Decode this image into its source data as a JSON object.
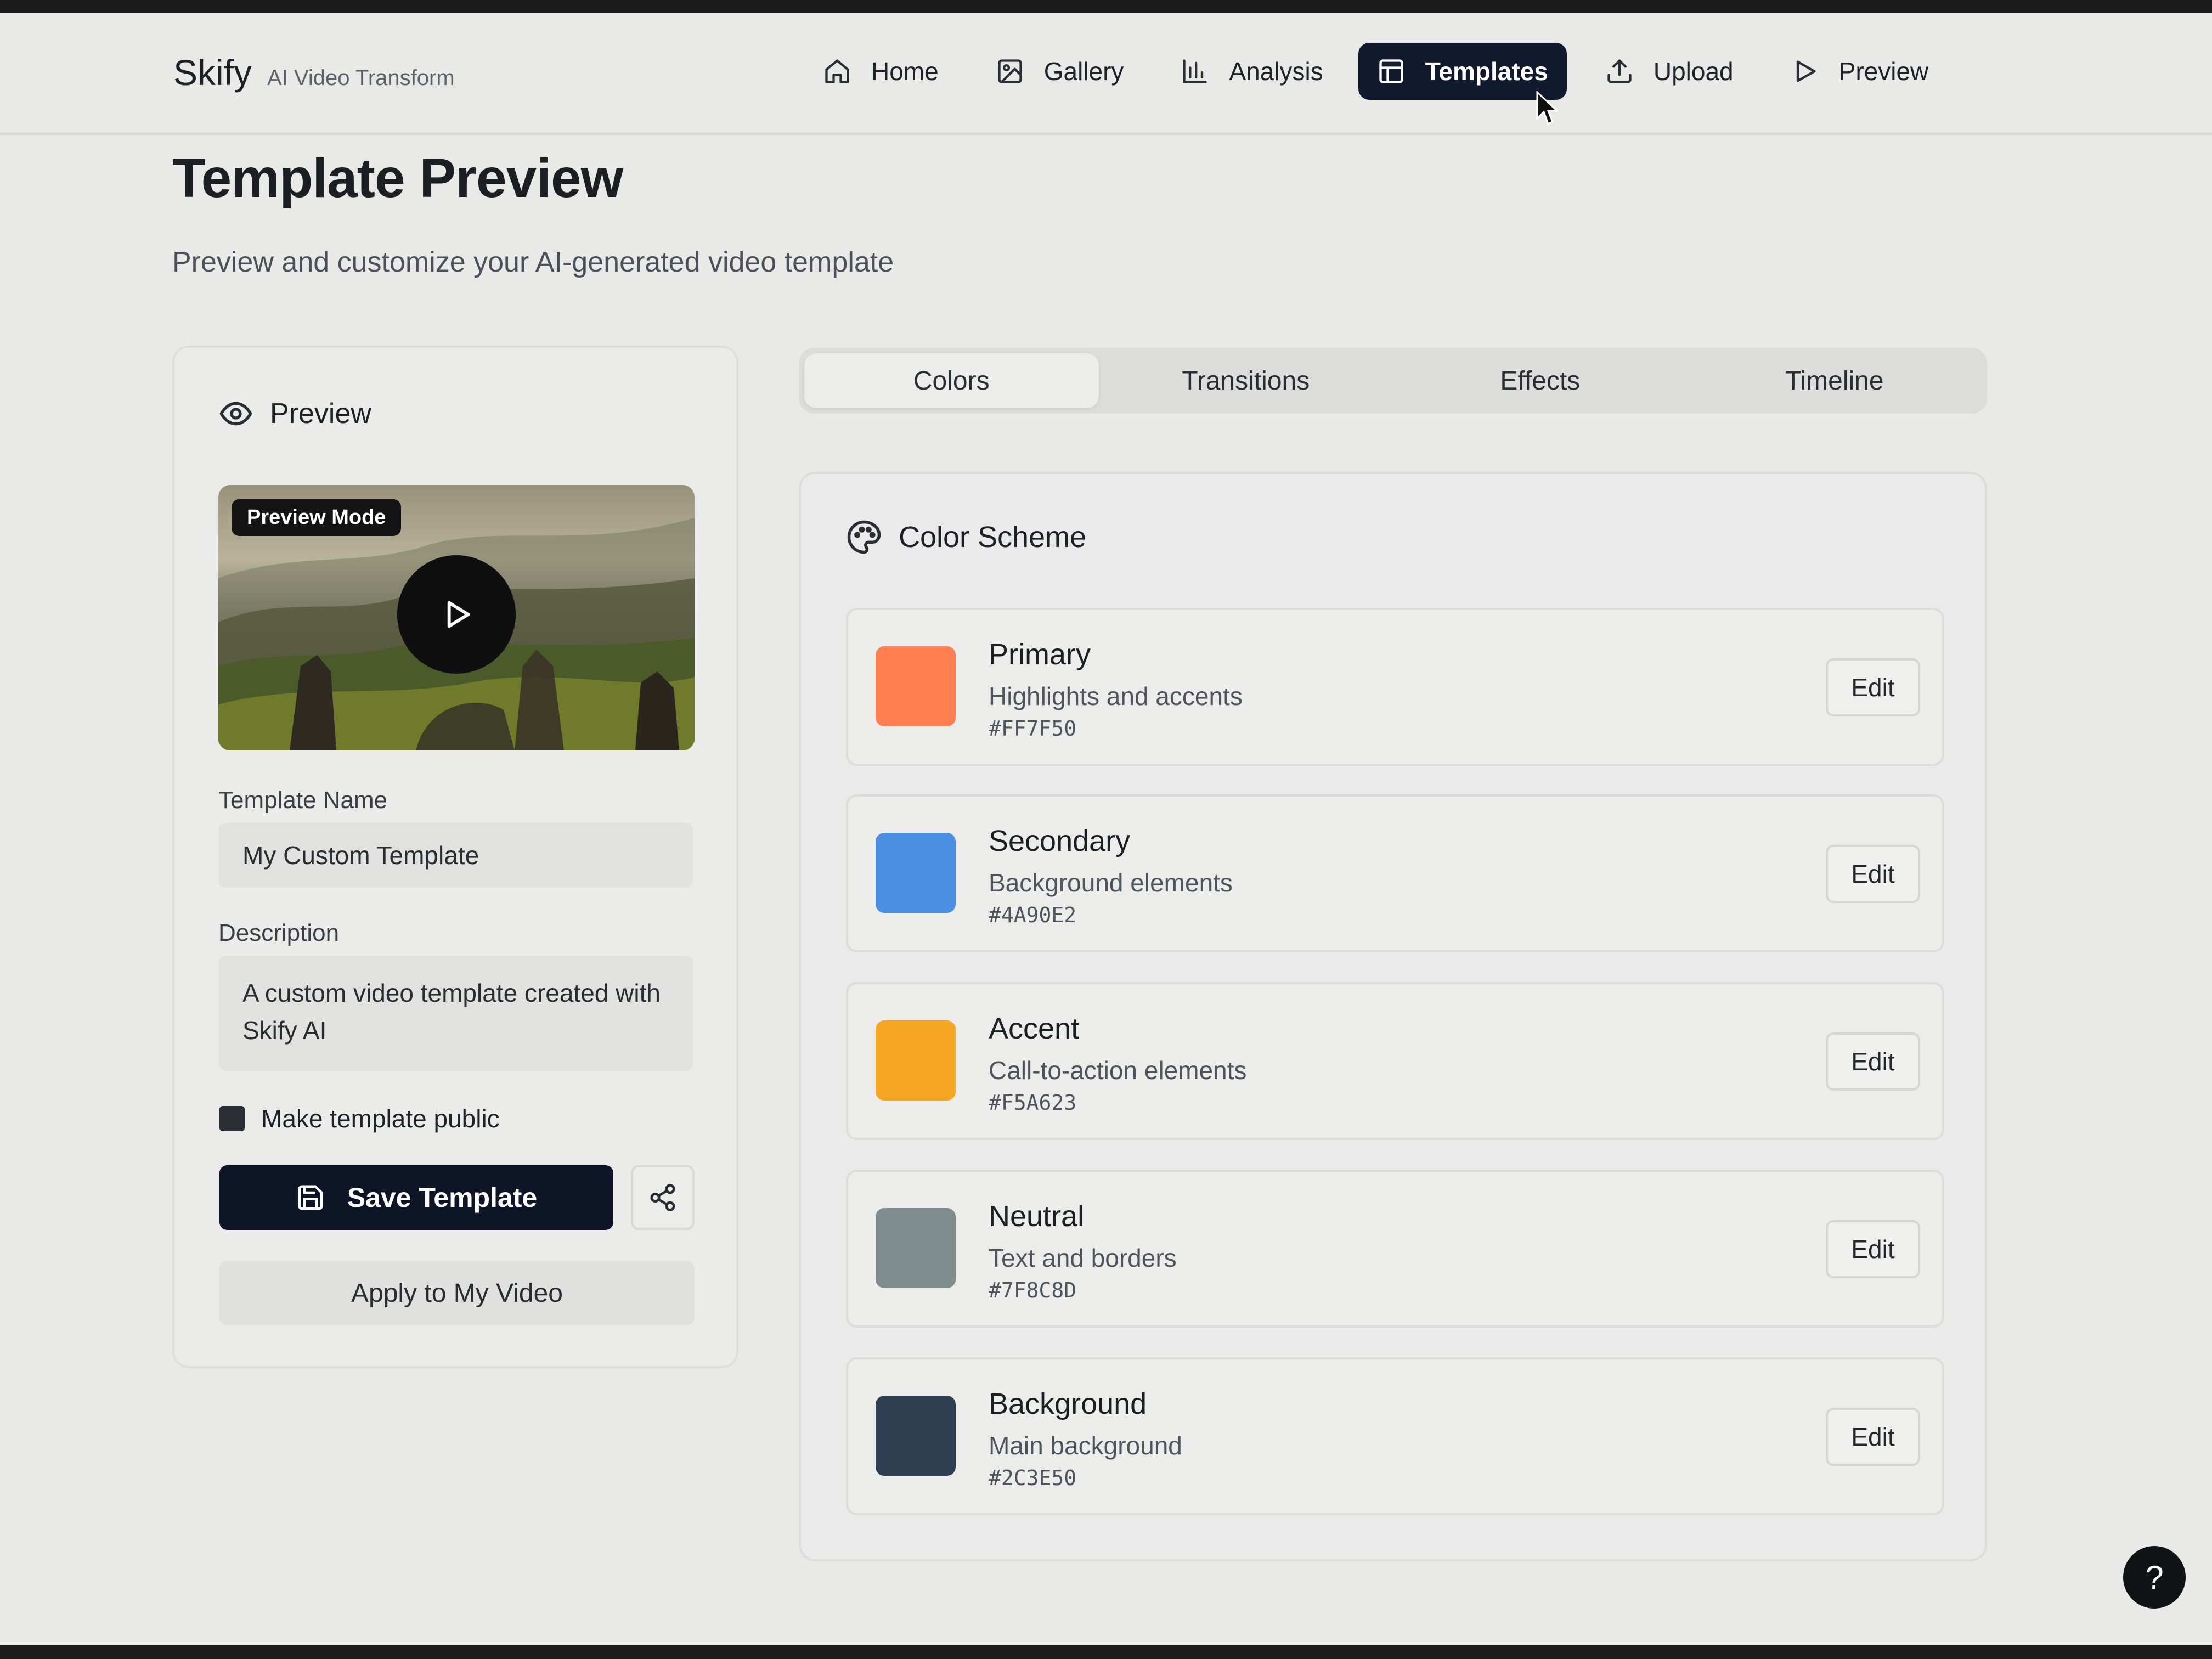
{
  "brand": {
    "name": "Skify",
    "tagline": "AI Video Transform"
  },
  "nav": [
    {
      "label": "Home",
      "icon": "home-icon",
      "active": false
    },
    {
      "label": "Gallery",
      "icon": "image-icon",
      "active": false
    },
    {
      "label": "Analysis",
      "icon": "bar-chart-icon",
      "active": false
    },
    {
      "label": "Templates",
      "icon": "layout-icon",
      "active": true
    },
    {
      "label": "Upload",
      "icon": "upload-icon",
      "active": false
    },
    {
      "label": "Preview",
      "icon": "play-icon",
      "active": false
    }
  ],
  "page": {
    "title": "Template Preview",
    "subtitle": "Preview and customize your AI-generated video template"
  },
  "preview_panel": {
    "title": "Preview",
    "badge": "Preview Mode",
    "name_label": "Template Name",
    "name_value": "My Custom Template",
    "description_label": "Description",
    "description_value": "A custom video template created with Skify AI",
    "public_label": "Make template public",
    "public_checked": true,
    "save_label": "Save Template",
    "apply_label": "Apply to My Video"
  },
  "tabs": [
    {
      "label": "Colors",
      "active": true
    },
    {
      "label": "Transitions",
      "active": false
    },
    {
      "label": "Effects",
      "active": false
    },
    {
      "label": "Timeline",
      "active": false
    }
  ],
  "color_scheme": {
    "title": "Color Scheme",
    "edit_label": "Edit",
    "colors": [
      {
        "name": "Primary",
        "description": "Highlights and accents",
        "hex": "#FF7F50"
      },
      {
        "name": "Secondary",
        "description": "Background elements",
        "hex": "#4A90E2"
      },
      {
        "name": "Accent",
        "description": "Call-to-action elements",
        "hex": "#F5A623"
      },
      {
        "name": "Neutral",
        "description": "Text and borders",
        "hex": "#7F8C8D"
      },
      {
        "name": "Background",
        "description": "Main background",
        "hex": "#2C3E50"
      }
    ]
  },
  "help": {
    "label": "?"
  }
}
